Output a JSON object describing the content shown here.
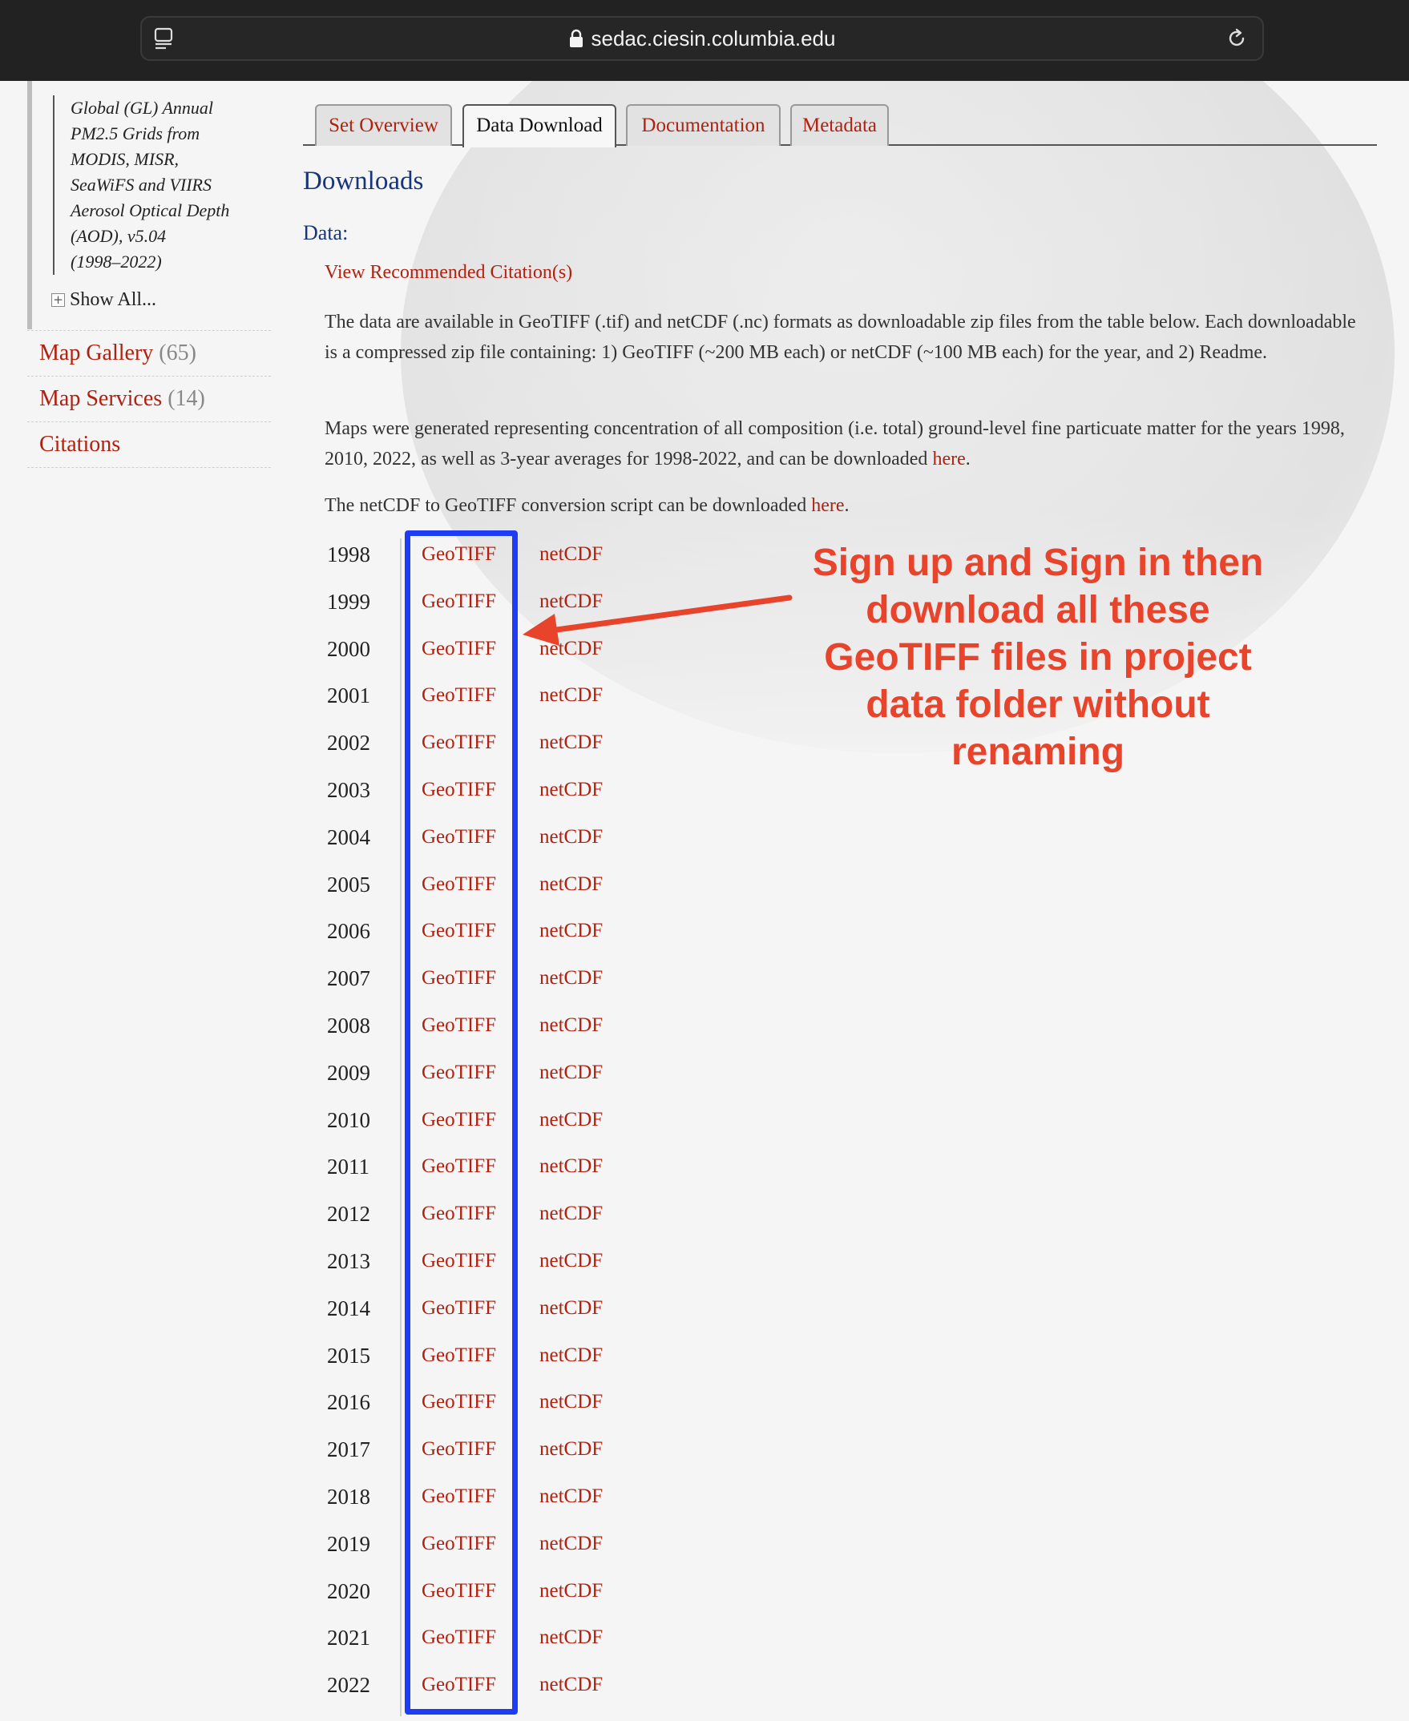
{
  "browser": {
    "url": "sedac.ciesin.columbia.edu"
  },
  "sidebar": {
    "sub_item_lines": [
      "Global (GL) Annual",
      "PM2.5 Grids from",
      "MODIS, MISR,",
      "SeaWiFS and VIIRS",
      "Aerosol Optical Depth",
      "(AOD), v5.04",
      "(1998–2022)"
    ],
    "show_all": "Show All...",
    "links": [
      {
        "label": "Map Gallery",
        "count": "(65)"
      },
      {
        "label": "Map Services",
        "count": "(14)"
      },
      {
        "label": "Citations",
        "count": ""
      }
    ]
  },
  "tabs": [
    "Set Overview",
    "Data Download",
    "Documentation",
    "Metadata"
  ],
  "active_tab": "Data Download",
  "content": {
    "downloads_heading": "Downloads",
    "data_heading": "Data:",
    "citation_link": "View Recommended Citation(s)",
    "para1": "The data are available in GeoTIFF (.tif) and netCDF (.nc) formats as downloadable zip files from the table below. Each downloadable is a compressed zip file containing: 1) GeoTIFF (~200 MB each) or netCDF (~100 MB each) for the year, and 2) Readme.",
    "para2_text": "Maps were generated representing concentration of all composition (i.e. total) ground-level fine particuate matter for the years 1998, 2010, 2022, as well as 3-year averages for 1998-2022, and can be downloaded ",
    "para2_link": "here",
    "para3_text": "The netCDF to GeoTIFF conversion script can be downloaded ",
    "para3_link": "here",
    "period": "."
  },
  "downloads_table": {
    "geotiff_label": "GeoTIFF",
    "netcdf_label": "netCDF",
    "years": [
      "1998",
      "1999",
      "2000",
      "2001",
      "2002",
      "2003",
      "2004",
      "2005",
      "2006",
      "2007",
      "2008",
      "2009",
      "2010",
      "2011",
      "2012",
      "2013",
      "2014",
      "2015",
      "2016",
      "2017",
      "2018",
      "2019",
      "2020",
      "2021",
      "2022"
    ]
  },
  "annotation": {
    "lines": [
      "Sign up and Sign in then",
      "download all these",
      "GeoTIFF files in project",
      "data folder without",
      "renaming"
    ],
    "text_color": "#e8432b",
    "box_color": "#1f3cf5"
  },
  "colors": {
    "link": "#b0210f",
    "heading": "#17357a",
    "chrome": "#222222"
  }
}
